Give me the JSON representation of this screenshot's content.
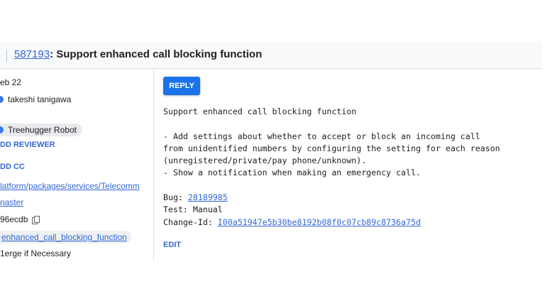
{
  "header": {
    "change_number": "587193",
    "change_title": ": Support enhanced call blocking function"
  },
  "sidebar": {
    "date": "eb 22",
    "owner": "takeshi tanigawa",
    "reviewer": "Treehugger Robot",
    "add_reviewer": "DD REVIEWER",
    "add_cc": "DD CC",
    "repo": "latform/packages/services/Telecomm",
    "branch": "naster",
    "commit": "96ecdb",
    "topic": "enhanced_call_blocking_function",
    "submit_type": "1erge if Necessary"
  },
  "main": {
    "reply_label": "REPLY",
    "message_body": "Support enhanced call blocking function\n\n- Add settings about whether to accept or block an incoming call\nfrom unidentified numbers by configuring the setting for each reason\n(unregistered/private/pay phone/unknown).\n- Show a notification when making an emergency call.\n\n",
    "bug_label": "Bug: ",
    "bug_id": "28189985",
    "test_line": "\nTest: Manual\n",
    "change_id_label": "Change-Id: ",
    "change_id": "I00a51947e5b30be8192b08f0c07cb89c8736a75d",
    "edit_label": "EDIT"
  },
  "colors": {
    "link": "#3367d6",
    "button": "#1a73e8",
    "header_bg": "#f8f9fa"
  }
}
